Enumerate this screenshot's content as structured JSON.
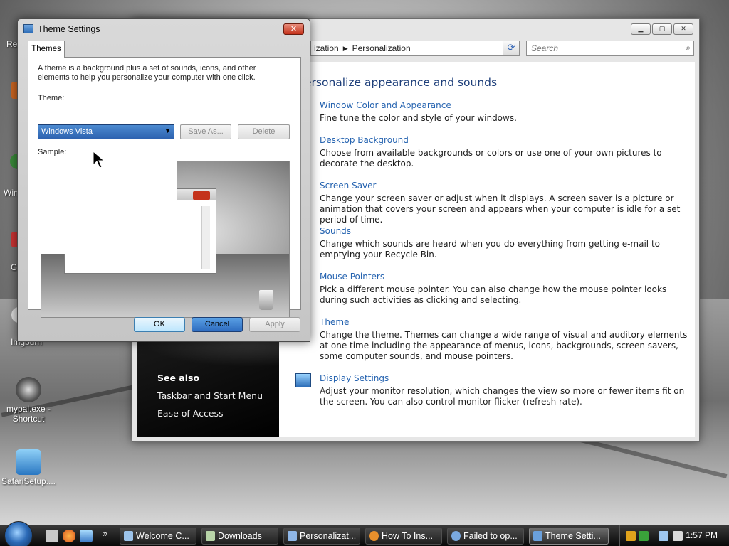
{
  "desktop": {
    "icons": [
      {
        "label": "mypal.exe -\nShortcut"
      },
      {
        "label": "SafariSetup...."
      }
    ],
    "partial_labels": [
      "Re",
      "Win",
      "C",
      "Imgburn"
    ]
  },
  "personalization_window": {
    "breadcrumb": {
      "crumb1": "ization",
      "sep": "▶",
      "crumb2": "Personalization"
    },
    "search_placeholder": "Search",
    "heading": "ersonalize appearance and sounds",
    "tasks": [
      {
        "title": "Window Color and Appearance",
        "desc": "Fine tune the color and style of your windows."
      },
      {
        "title": "Desktop Background",
        "desc": "Choose from available backgrounds or colors or use one of your own pictures to decorate the desktop."
      },
      {
        "title": "Screen Saver",
        "desc": "Change your screen saver or adjust when it displays. A screen saver is a picture or animation that covers your screen and appears when your computer is idle for a set period of time."
      },
      {
        "title": "Sounds",
        "desc": "Change which sounds are heard when you do everything from getting e-mail to emptying your Recycle Bin."
      },
      {
        "title": "Mouse Pointers",
        "desc": "Pick a different mouse pointer. You can also change how the mouse pointer looks during such activities as clicking and selecting."
      },
      {
        "title": "Theme",
        "desc": "Change the theme. Themes can change a wide range of visual and auditory elements at one time including the appearance of menus, icons, backgrounds, screen savers, some computer sounds, and mouse pointers."
      },
      {
        "title": "Display Settings",
        "desc": "Adjust your monitor resolution, which changes the view so more or fewer items fit on the screen. You can also control monitor flicker (refresh rate)."
      }
    ],
    "see_also": {
      "heading": "See also",
      "links": [
        "Taskbar and Start Menu",
        "Ease of Access"
      ]
    }
  },
  "theme_dialog": {
    "title": "Theme Settings",
    "close_glyph": "✕",
    "tab": "Themes",
    "description": "A theme is a background plus a set of sounds, icons, and other elements to help you personalize your computer with one click.",
    "theme_label": "Theme:",
    "theme_value": "Windows Vista",
    "save_as": "Save As...",
    "delete": "Delete",
    "sample_label": "Sample:",
    "ok": "OK",
    "cancel": "Cancel",
    "apply": "Apply"
  },
  "taskbar": {
    "items": [
      {
        "label": "Welcome C..."
      },
      {
        "label": "Downloads"
      },
      {
        "label": "Personalizat..."
      },
      {
        "label": "How To Ins..."
      },
      {
        "label": "Failed to op..."
      },
      {
        "label": "Theme Setti..."
      }
    ],
    "overflow": "»",
    "clock": "1:57 PM"
  },
  "colors": {
    "link": "#2563b0",
    "heading": "#1e3f7a",
    "close_red": "#c4321b"
  }
}
